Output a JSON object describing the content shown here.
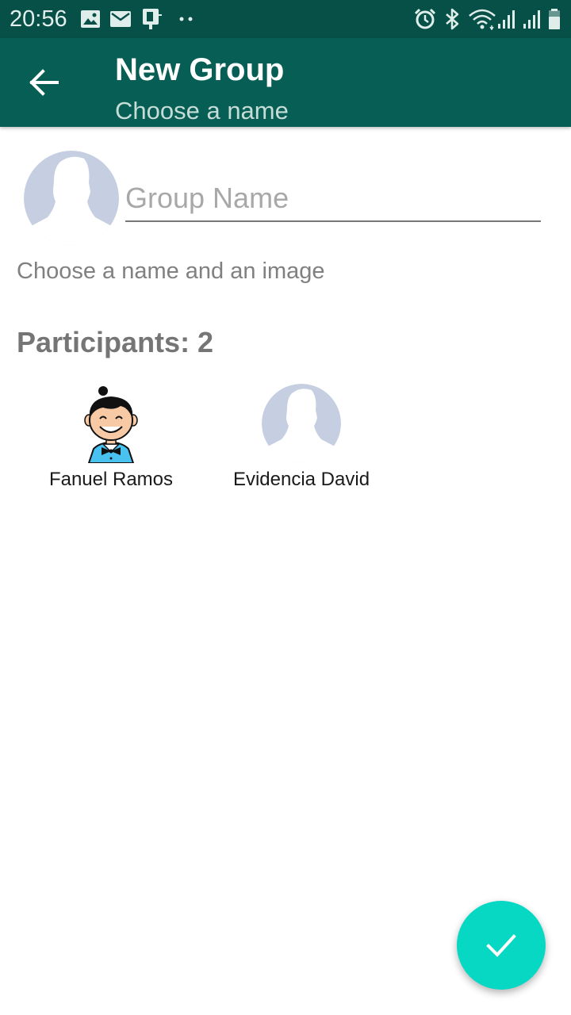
{
  "status_bar": {
    "time": "20:56",
    "left_icons": [
      "image-icon",
      "mail-icon",
      "device-icon",
      "more-dots-icon"
    ],
    "right_icons": [
      "alarm-icon",
      "bluetooth-icon",
      "wifi-icon",
      "signal-icon",
      "signal-icon",
      "battery-icon"
    ]
  },
  "toolbar": {
    "title": "New Group",
    "subtitle": "Choose a name",
    "back_icon": "arrow-back-icon"
  },
  "group": {
    "name_placeholder": "Group Name",
    "name_value": "",
    "hint": "Choose a name and an image"
  },
  "participants": {
    "label": "Participants: 2",
    "items": [
      {
        "name": "Fanuel Ramos",
        "avatar": "cartoon-boy-avatar"
      },
      {
        "name": "Evidencia David",
        "avatar": "default-avatar"
      }
    ]
  },
  "fab": {
    "icon": "check-icon"
  },
  "colors": {
    "status_bar": "#075048",
    "toolbar": "#075e54",
    "toolbar_subtitle": "#c6dcd7",
    "avatar_placeholder": "#c5cfe1",
    "fab": "#07d8c4",
    "participants_title": "#757575"
  }
}
